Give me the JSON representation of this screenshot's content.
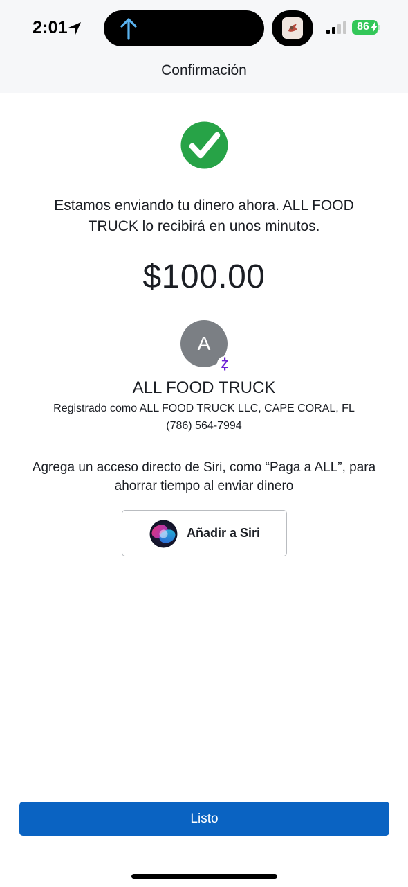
{
  "status_bar": {
    "time": "2:01",
    "battery": "86"
  },
  "nav": {
    "title": "Confirmación"
  },
  "confirmation": {
    "message": "Estamos enviando tu dinero ahora. ALL FOOD TRUCK lo recibirá en unos minutos.",
    "amount": "$100.00"
  },
  "recipient": {
    "initial": "A",
    "badge": "Z",
    "name": "ALL FOOD TRUCK",
    "registered": "Registrado como ALL FOOD TRUCK LLC, CAPE CORAL, FL",
    "phone": "(786) 564-7994"
  },
  "siri": {
    "description": "Agrega un acceso directo de Siri, como “Paga a ALL”, para ahorrar tiempo al enviar dinero",
    "button_label": "Añadir a Siri"
  },
  "footer": {
    "done_label": "Listo"
  },
  "colors": {
    "primary": "#0a63c2",
    "success": "#27a347",
    "zelle": "#6d1ed4",
    "battery": "#33c759"
  }
}
